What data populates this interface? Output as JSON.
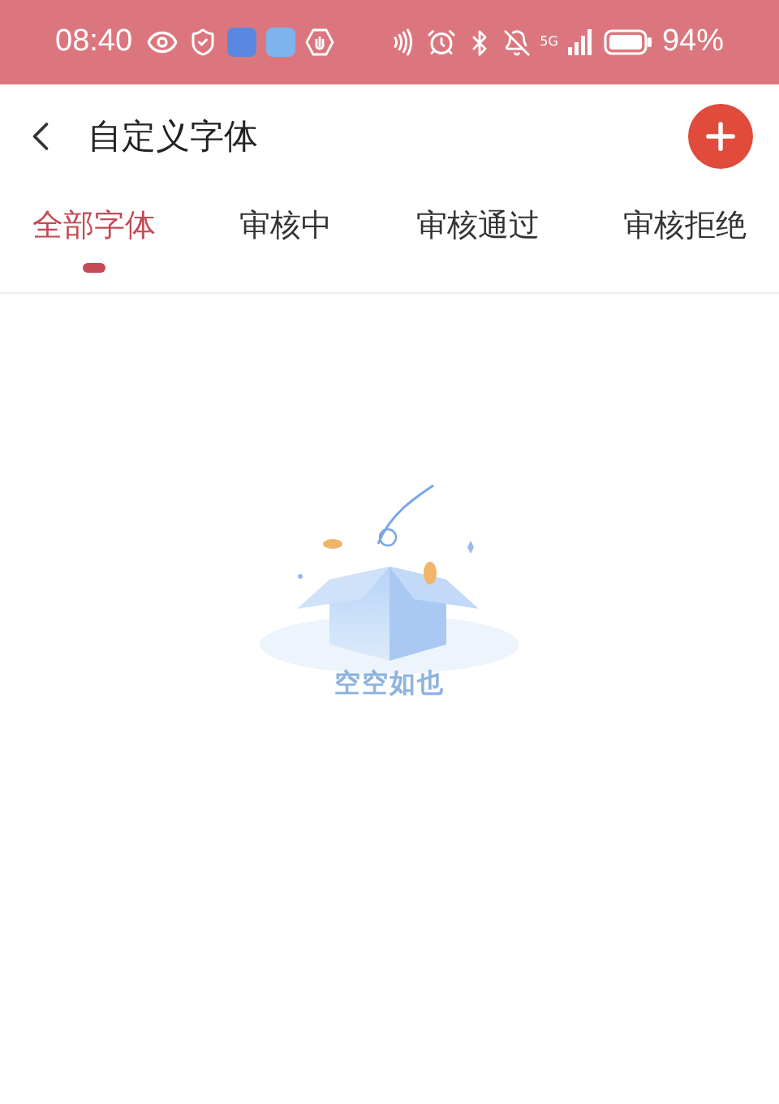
{
  "status_bar": {
    "time": "08:40",
    "battery": "94%",
    "signal_label": "5G"
  },
  "header": {
    "title": "自定义字体"
  },
  "tabs": [
    {
      "label": "全部字体",
      "selected": true
    },
    {
      "label": "审核中",
      "selected": false
    },
    {
      "label": "审核通过",
      "selected": false
    },
    {
      "label": "审核拒绝",
      "selected": false
    }
  ],
  "empty_state": {
    "message": "空空如也"
  }
}
